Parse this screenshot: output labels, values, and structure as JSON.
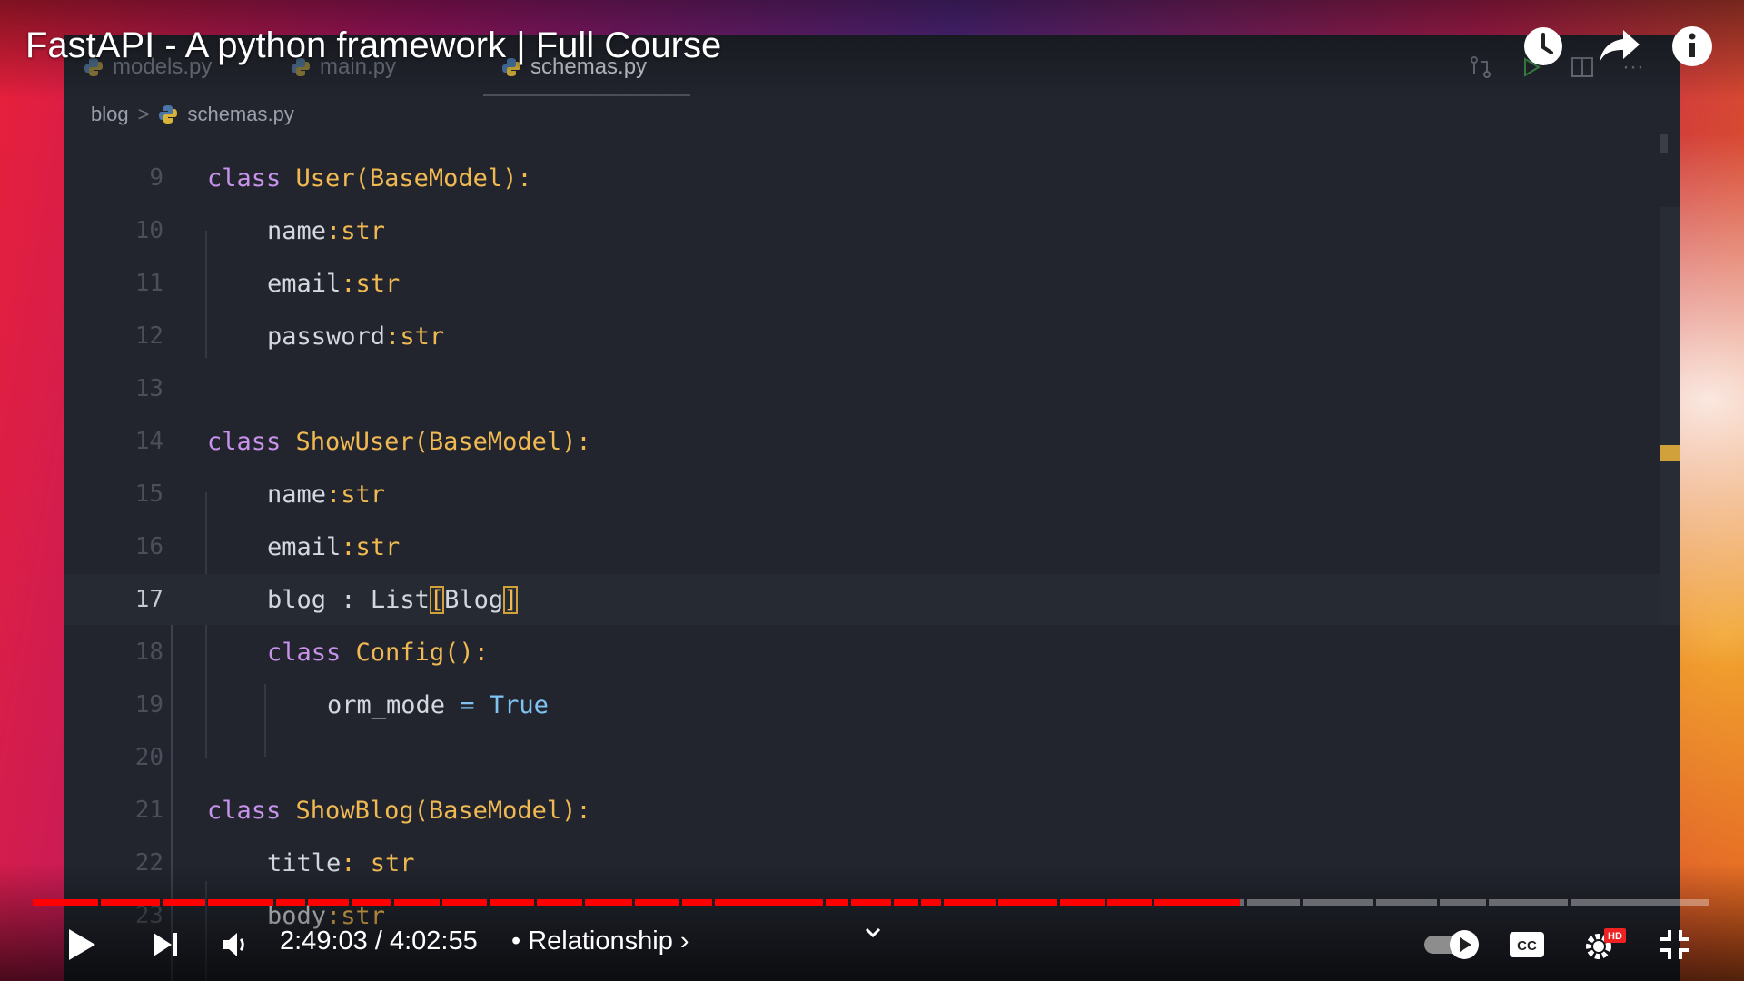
{
  "video": {
    "title": "FastAPI - A python framework | Full Course",
    "current_time": "2:49:03",
    "duration": "4:02:55",
    "time_separator": "/",
    "chapter_bullet": "•",
    "chapter": "Relationship",
    "chapter_arrow": "›",
    "progress_played": 0.72,
    "quality_badge": "HD",
    "cc_label": "CC",
    "accent": "#ff0000"
  },
  "editor": {
    "tabs": [
      {
        "label": "models.py"
      },
      {
        "label": "main.py"
      },
      {
        "label": "schemas.py"
      }
    ],
    "breadcrumb": {
      "folder": "blog",
      "separator": ">",
      "file": "schemas.py"
    },
    "lines": [
      {
        "n": "9"
      },
      {
        "n": "10"
      },
      {
        "n": "11"
      },
      {
        "n": "12"
      },
      {
        "n": "13"
      },
      {
        "n": "14"
      },
      {
        "n": "15"
      },
      {
        "n": "16"
      },
      {
        "n": "17"
      },
      {
        "n": "18"
      },
      {
        "n": "19"
      },
      {
        "n": "20"
      },
      {
        "n": "21"
      },
      {
        "n": "22"
      },
      {
        "n": "23"
      }
    ],
    "code": {
      "l9": {
        "kw": "class",
        "name": "User",
        "paren_open": "(",
        "base": "BaseModel",
        "tail": "):"
      },
      "l10": {
        "field": "name",
        "colon": ":",
        "type": "str"
      },
      "l11": {
        "field": "email",
        "colon": ":",
        "type": "str"
      },
      "l12": {
        "field": "password",
        "colon": ":",
        "type": "str"
      },
      "l14": {
        "kw": "class",
        "name": "ShowUser",
        "paren_open": "(",
        "base": "BaseModel",
        "tail": "):"
      },
      "l15": {
        "field": "name",
        "colon": ":",
        "type": "str"
      },
      "l16": {
        "field": "email",
        "colon": ":",
        "type": "str"
      },
      "l17": {
        "field": "blog",
        "sep": " : ",
        "type": "List",
        "open": "[",
        "inner": "Blog",
        "close": "]"
      },
      "l18": {
        "kw": "class",
        "name": "Config",
        "tail": "():"
      },
      "l19": {
        "field": "orm_mode",
        "op": " = ",
        "value": "True"
      },
      "l21": {
        "kw": "class",
        "name": "ShowBlog",
        "paren_open": "(",
        "base": "BaseModel",
        "tail": "):"
      },
      "l22": {
        "field": "title",
        "colon": ": ",
        "type": "str"
      },
      "l23": {
        "field": "body",
        "colon": ":",
        "type": "str"
      }
    }
  },
  "icons": {
    "watch_later": "clock-icon",
    "share": "share-icon",
    "info": "info-icon",
    "play": "play-icon",
    "next": "next-icon",
    "volume": "volume-icon",
    "autoplay": "autoplay-toggle-icon",
    "captions": "captions-icon",
    "settings": "settings-gear-icon",
    "fullscreen": "exit-fullscreen-icon",
    "chapters": "chevron-down-icon"
  }
}
